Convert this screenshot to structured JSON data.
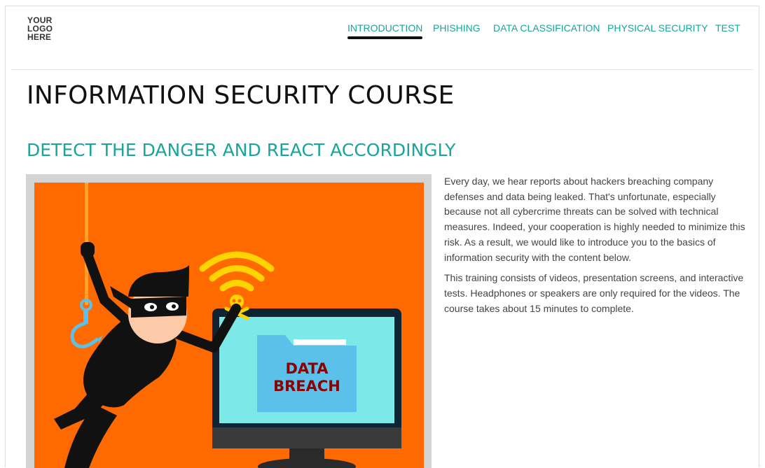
{
  "header": {
    "logo_text": "YOUR\nLOGO\nHERE",
    "nav": [
      {
        "label": "INTRODUCTION",
        "active": true
      },
      {
        "label": "PHISHING",
        "active": false
      },
      {
        "label": "DATA CLASSIFICATION",
        "active": false
      },
      {
        "label": "PHYSICAL SECURITY",
        "active": false
      },
      {
        "label": "TEST",
        "active": false
      }
    ]
  },
  "main": {
    "title": "INFORMATION SECURITY COURSE",
    "section_title": "DETECT THE DANGER AND REACT ACCORDINGLY",
    "hero": {
      "folder_label_line1": "DATA",
      "folder_label_line2": "BREACH"
    },
    "paragraphs": [
      "Every day, we hear reports about hackers breaching company defenses and data being leaked. That's unfortunate, especially because not all cybercrime threats can be solved with technical measures. Indeed, your cooperation is highly needed to minimize this risk. As a result, we would like to introduce you to the basics of information security with the content below.",
      "This training consists of videos, presentation screens, and interactive tests. Headphones or speakers are only required for the videos. The course takes about 15 minutes to complete."
    ]
  },
  "colors": {
    "accent": "#19a598",
    "hero_background": "#ff6a00",
    "wifi": "#ffd400",
    "screen": "#7de8e8",
    "folder": "#5bc0ea",
    "breach_text": "#8b0000"
  }
}
